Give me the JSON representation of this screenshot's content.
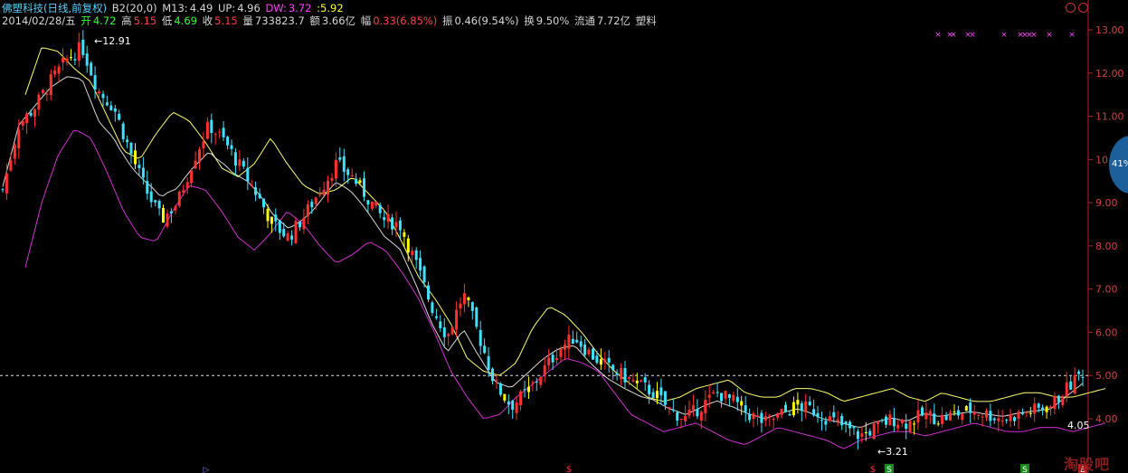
{
  "header": {
    "title": "佛塑科技(日线,前复权)",
    "b2": "B2(20,0)",
    "m13_label": "M13:",
    "m13_value": "4.49",
    "up_label": "UP:",
    "up_value": "4.96",
    "dw_label": "DW:",
    "dw_value": "3.72",
    "extra_value": ":5.92",
    "date": "2014/02/28/五",
    "open_label": "开",
    "open_value": "4.72",
    "high_label": "高",
    "high_value": "5.15",
    "low_label": "低",
    "low_value": "4.69",
    "close_label": "收",
    "close_value": "5.15",
    "volume_label": "量",
    "volume_value": "733823.7",
    "amount_label": "额",
    "amount_value": "3.66亿",
    "change_label": "幅",
    "change_value": "0.33(6.85%)",
    "amplitude_label": "振",
    "amplitude_value": "0.46(9.54%)",
    "turnover_label": "换",
    "turnover_value": "9.50%",
    "float_label": "流通",
    "float_value": "7.72亿",
    "sector": "塑料"
  },
  "right_badge": "41%",
  "watermark": "淘股吧",
  "colors": {
    "up_candle": "#ff3030",
    "down_candle": "#40e0ff",
    "yellow_bar": "#ffff00",
    "upper_band": "#ffff70",
    "lower_band": "#d030d0",
    "mid_line": "#ffffff",
    "axis": "#c02020",
    "current_price_line": "#e0e0e0"
  },
  "markers": {
    "sell": "S",
    "buy": "B",
    "dollar": "$"
  },
  "chart_data": {
    "type": "candlestick",
    "ylim": [
      3.0,
      13.3
    ],
    "y_ticks": [
      "13.00",
      "12.00",
      "11.00",
      "10.00",
      "9.00",
      "8.00",
      "7.00",
      "6.00",
      "5.00",
      "4.00"
    ],
    "annotations": {
      "high_label": "12.91",
      "low_label": "3.21",
      "last_label": "4.05"
    },
    "current_price": 5.0,
    "close_path": [
      9.3,
      10.8,
      11.2,
      11.8,
      12.3,
      12.6,
      11.6,
      11.2,
      10.2,
      9.3,
      8.6,
      9.0,
      10.0,
      10.8,
      10.4,
      9.8,
      9.2,
      8.5,
      8.2,
      8.7,
      9.3,
      9.9,
      9.6,
      9.1,
      8.6,
      8.5,
      7.6,
      6.6,
      5.9,
      6.9,
      5.9,
      4.8,
      4.3,
      4.6,
      5.1,
      5.6,
      5.9,
      5.5,
      5.2,
      5.0,
      4.8,
      4.6,
      4.2,
      4.0,
      4.3,
      4.6,
      4.4,
      4.1,
      3.9,
      4.1,
      4.3,
      4.2,
      4.0,
      3.8,
      3.6,
      3.8,
      4.0,
      3.9,
      4.1,
      4.0,
      4.1,
      4.2,
      4.1,
      4.0,
      4.1,
      4.2,
      4.3,
      4.7,
      5.1
    ],
    "upper_band_path": [
      11.5,
      12.6,
      12.5,
      12.1,
      11.8,
      11.0,
      10.2,
      10.0,
      10.6,
      11.1,
      10.9,
      10.4,
      9.8,
      9.6,
      9.9,
      10.5,
      9.9,
      9.4,
      9.2,
      9.3,
      9.6,
      9.2,
      8.8,
      8.1,
      7.3,
      6.8,
      6.2,
      5.4,
      5.1,
      5.0,
      5.3,
      6.1,
      6.6,
      6.4,
      6.0,
      5.5,
      5.1,
      4.8,
      4.5,
      4.4,
      4.5,
      4.7,
      4.8,
      4.9,
      4.6,
      4.5,
      4.5,
      4.7,
      4.7,
      4.6,
      4.4,
      4.5,
      4.6,
      4.7,
      4.5,
      4.4,
      4.6,
      4.5,
      4.4,
      4.4,
      4.5,
      4.6,
      4.6,
      4.5,
      4.5,
      4.6,
      4.7
    ],
    "lower_band_path": [
      7.5,
      9.0,
      10.1,
      10.7,
      10.5,
      9.7,
      8.8,
      8.2,
      8.1,
      8.8,
      9.4,
      9.3,
      8.8,
      8.2,
      7.9,
      8.3,
      8.8,
      8.5,
      8.0,
      7.6,
      7.8,
      8.1,
      7.9,
      7.4,
      6.8,
      6.0,
      5.1,
      4.5,
      4.0,
      4.1,
      4.5,
      4.8,
      5.1,
      5.4,
      5.3,
      5.1,
      4.6,
      4.1,
      3.9,
      3.7,
      3.8,
      3.9,
      3.7,
      3.5,
      3.4,
      3.6,
      3.8,
      3.7,
      3.6,
      3.5,
      3.3,
      3.5,
      3.6,
      3.7,
      3.7,
      3.6,
      3.7,
      3.8,
      3.9,
      3.8,
      3.7,
      3.7,
      3.8,
      3.8,
      3.7,
      3.8,
      3.9
    ]
  }
}
